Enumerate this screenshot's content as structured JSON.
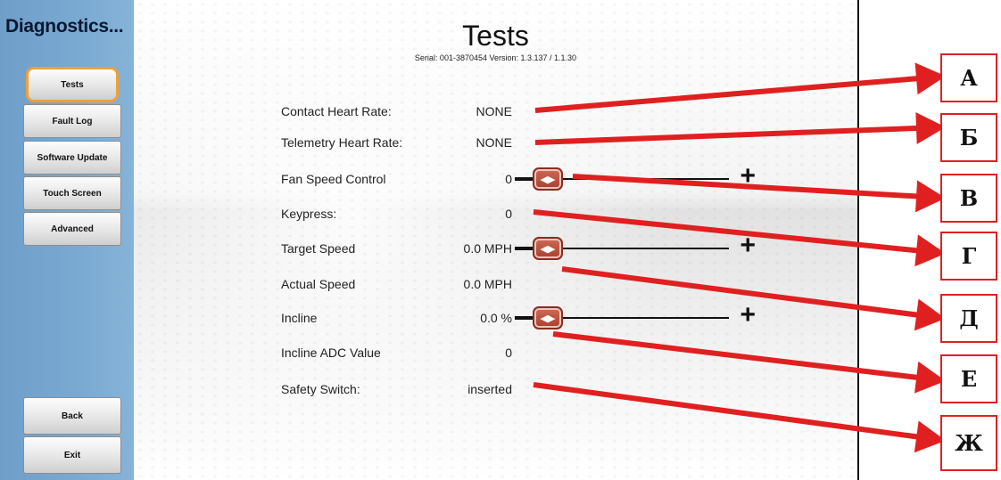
{
  "sidebar": {
    "title": "Diagnostics...",
    "items": [
      {
        "label": "Tests",
        "active": true
      },
      {
        "label": "Fault Log"
      },
      {
        "label": "Software Update"
      },
      {
        "label": "Touch Screen"
      },
      {
        "label": "Advanced"
      }
    ],
    "bottom": [
      {
        "label": "Back"
      },
      {
        "label": "Exit"
      }
    ]
  },
  "header": {
    "title": "Tests",
    "subtitle": "Serial: 001-3870454   Version: 1.3.137 / 1.1.30"
  },
  "rows": [
    {
      "label": "Contact Heart Rate:",
      "value": "NONE"
    },
    {
      "label": "Telemetry Heart Rate:",
      "value": "NONE"
    },
    {
      "label": "Fan Speed Control",
      "value": "0",
      "slider": true
    },
    {
      "label": "Keypress:",
      "value": "0"
    },
    {
      "label": "Target Speed",
      "value": "0.0 MPH",
      "slider": true
    },
    {
      "label": "Actual Speed",
      "value": "0.0 MPH"
    },
    {
      "label": "Incline",
      "value": "0.0 %",
      "slider": true
    },
    {
      "label": "Incline ADC Value",
      "value": "0"
    },
    {
      "label": "Safety Switch:",
      "value": "inserted"
    }
  ],
  "slider_icons": {
    "knob": "left-right-arrows-icon",
    "increase": "plus-icon"
  },
  "callouts": [
    "А",
    "Б",
    "В",
    "Г",
    "Д",
    "Е",
    "Ж"
  ],
  "colors": {
    "arrow": "#e02020",
    "active_border": "#f0a038",
    "sidebar": "#7aaad2"
  }
}
